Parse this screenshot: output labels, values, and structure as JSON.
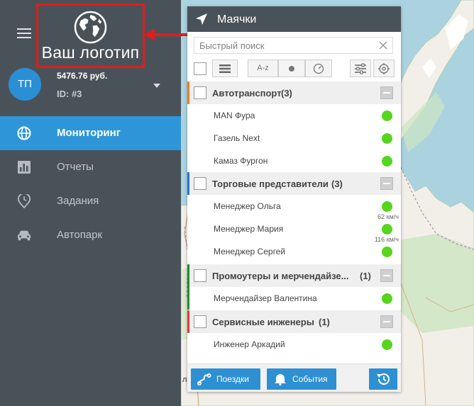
{
  "logo": {
    "text": "Ваш логотип",
    "icon": "globe-icon"
  },
  "user": {
    "initials": "ТП",
    "balance": "5476.76 руб.",
    "id": "ID: #3"
  },
  "nav": {
    "items": [
      {
        "label": "Мониторинг",
        "icon": "globe-icon",
        "active": true
      },
      {
        "label": "Отчеты",
        "icon": "bar-chart-icon",
        "active": false
      },
      {
        "label": "Задания",
        "icon": "map-pin-clock-icon",
        "active": false
      },
      {
        "label": "Автопарк",
        "icon": "car-icon",
        "active": false
      }
    ]
  },
  "panel": {
    "title": "Маячки",
    "search_placeholder": "Быстрый поиск",
    "sort_label": "A-z",
    "groups": [
      {
        "name": "Автотранспорт",
        "count": "(3)",
        "color": "#f07f1d",
        "items": [
          {
            "name": "MAN Фура",
            "status_color": "#56d51d",
            "speed": ""
          },
          {
            "name": "Газель Next",
            "status_color": "#56d51d",
            "speed": ""
          },
          {
            "name": "Камаз Фургон",
            "status_color": "#56d51d",
            "speed": ""
          }
        ]
      },
      {
        "name": "Торговые представители",
        "count": "(3)",
        "color": "#2f6fe0",
        "items": [
          {
            "name": "Менеджер Ольга",
            "status_color": "#56d51d",
            "speed": "62 км/ч"
          },
          {
            "name": "Менеджер Мария",
            "status_color": "#56d51d",
            "speed": "116 км/ч"
          },
          {
            "name": "Менеджер Сергей",
            "status_color": "#56d51d",
            "speed": ""
          }
        ]
      },
      {
        "name": "Промоутеры и мерчендайзе...",
        "count": "(1)",
        "color": "#1e8f2b",
        "items": [
          {
            "name": "Мерчендайзер Валентина",
            "status_color": "#56d51d",
            "speed": ""
          }
        ]
      },
      {
        "name": "Сервисные инженеры",
        "count": "(1)",
        "color": "#e23a3a",
        "items": [
          {
            "name": "Инженер Аркадий",
            "status_color": "#56d51d",
            "speed": ""
          }
        ]
      }
    ],
    "footer": {
      "trips_label": "Поездки",
      "events_label": "События"
    }
  },
  "colors": {
    "sidebar_bg": "#4a5259",
    "accent": "#2e96d8",
    "highlight_border": "#e01c1c",
    "status_online": "#56d51d"
  },
  "map": {
    "partial_label": "лэ"
  }
}
